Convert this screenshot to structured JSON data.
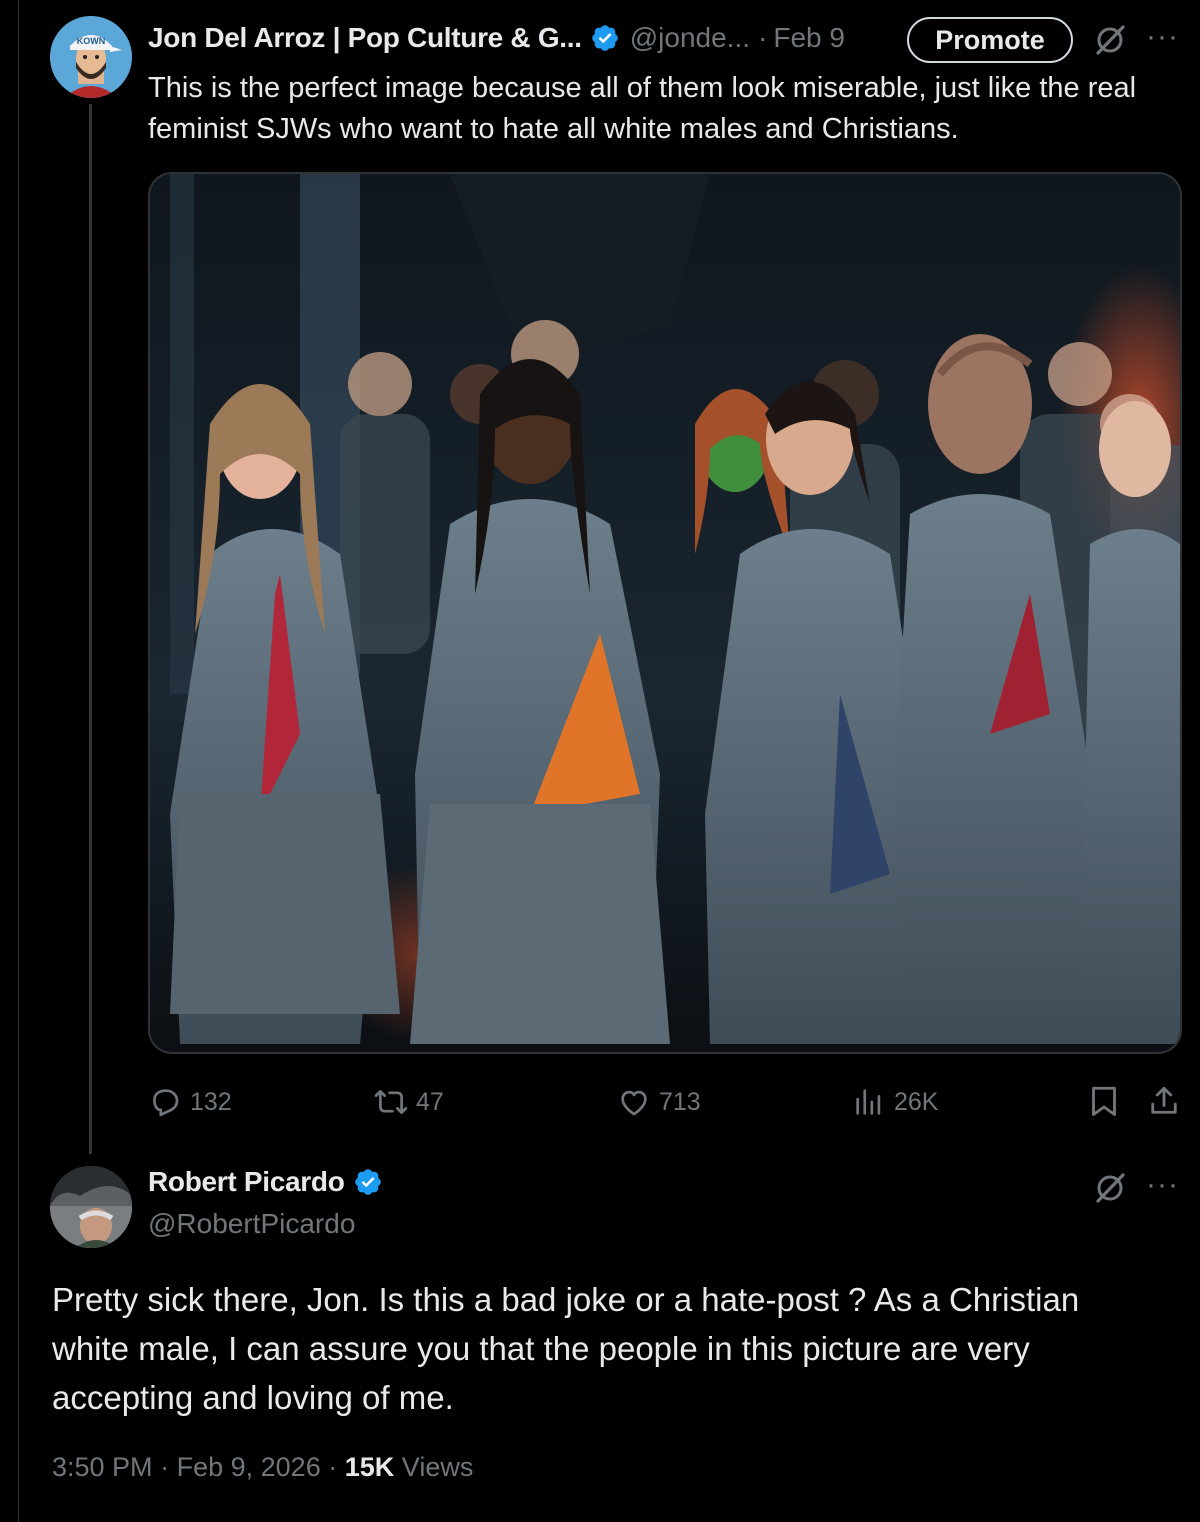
{
  "tweet": {
    "display_name": "Jon Del Arroz | Pop Culture & G...",
    "handle": "@jonde...",
    "separator": "·",
    "date": "Feb 9",
    "promote_label": "Promote",
    "text": "This is the perfect image because all of them look miserable, just like the real feminist SJWs who want to hate all white males and Christians.",
    "avatar_cap_text": "KOWN",
    "stats": {
      "replies": "132",
      "reposts": "47",
      "likes": "713",
      "views": "26K"
    },
    "icons": {
      "verified": "verified-badge-icon",
      "grok": "grok-icon",
      "more": "more-icon",
      "reply": "reply-icon",
      "repost": "repost-icon",
      "like": "heart-icon",
      "views": "views-chart-icon",
      "bookmark": "bookmark-icon",
      "share": "share-icon"
    }
  },
  "reply": {
    "display_name": "Robert Picardo",
    "handle": "@RobertPicardo",
    "text": "Pretty sick there, Jon. Is this a bad joke or a hate-post ? As a Christian white male, I can assure you that the people in this picture are very accepting and loving of me.",
    "time": "3:50 PM",
    "separator": "·",
    "date": "Feb 9, 2026",
    "views_count": "15K",
    "views_label": "Views"
  },
  "colors": {
    "background": "#000000",
    "text_primary": "#e7e9ea",
    "text_secondary": "#71767b",
    "verified_blue": "#1d9bf0",
    "border": "#2f3336"
  }
}
